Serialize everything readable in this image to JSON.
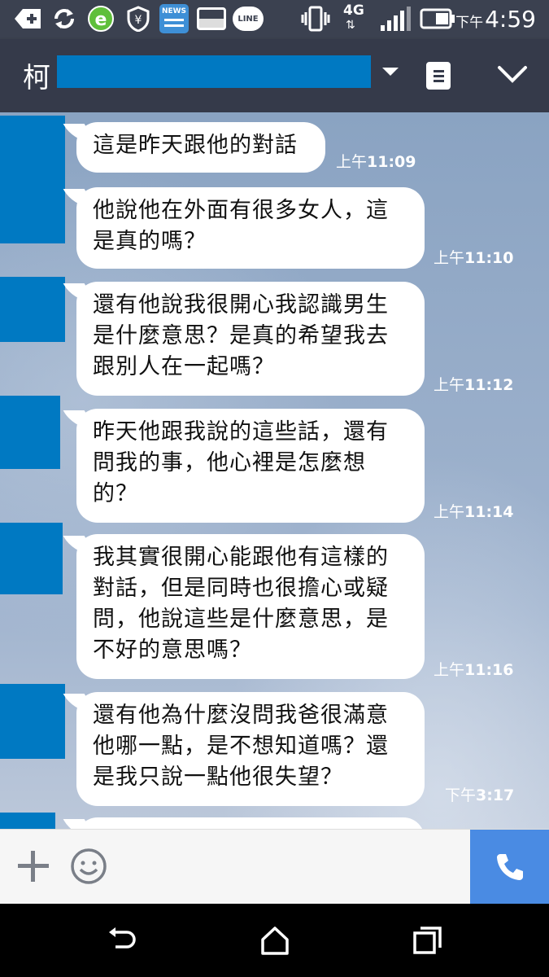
{
  "status_bar": {
    "network": "4G",
    "time_ampm": "下午",
    "time": "4:59",
    "icons": [
      "add-icon",
      "sync-icon",
      "browser-icon",
      "shield-icon",
      "news-icon",
      "gallery-icon",
      "line-icon",
      "vibrate-icon",
      "signal-icon",
      "battery-icon"
    ],
    "news_label": "NEWS",
    "line_label": "LINE"
  },
  "header": {
    "chat_name_initial": "柯",
    "chat_name_redacted": true
  },
  "messages": [
    {
      "lines": [
        "這是昨天跟他的對話"
      ],
      "ampm": "上午",
      "time": "11:09"
    },
    {
      "lines": [
        "他說他在外面有很多女人，這",
        "是真的嗎？"
      ],
      "ampm": "上午",
      "time": "11:10"
    },
    {
      "lines": [
        "還有他說我很開心我認識男生",
        "是什麼意思？是真的希望我去",
        "跟別人在一起嗎？"
      ],
      "ampm": "上午",
      "time": "11:12"
    },
    {
      "lines": [
        "昨天他跟我說的這些話，還有",
        "問我的事，他心裡是怎麼想",
        "的？"
      ],
      "ampm": "上午",
      "time": "11:14"
    },
    {
      "lines": [
        "我其實很開心能跟他有這樣的",
        "對話，但是同時也很擔心或疑",
        "問，他說這些是什麼意思，是",
        "不好的意思嗎？"
      ],
      "ampm": "上午",
      "time": "11:16"
    },
    {
      "lines": [
        "還有他為什麼沒問我爸很滿意",
        "他哪一點，是不想知道嗎？還",
        "是我只說一點他很失望？"
      ],
      "ampm": "下午",
      "time": "3:17"
    }
  ],
  "colors": {
    "redaction": "#0079c2",
    "header_bg": "#353a4a",
    "call_button": "#4a8be3",
    "bubble": "#ffffff"
  }
}
